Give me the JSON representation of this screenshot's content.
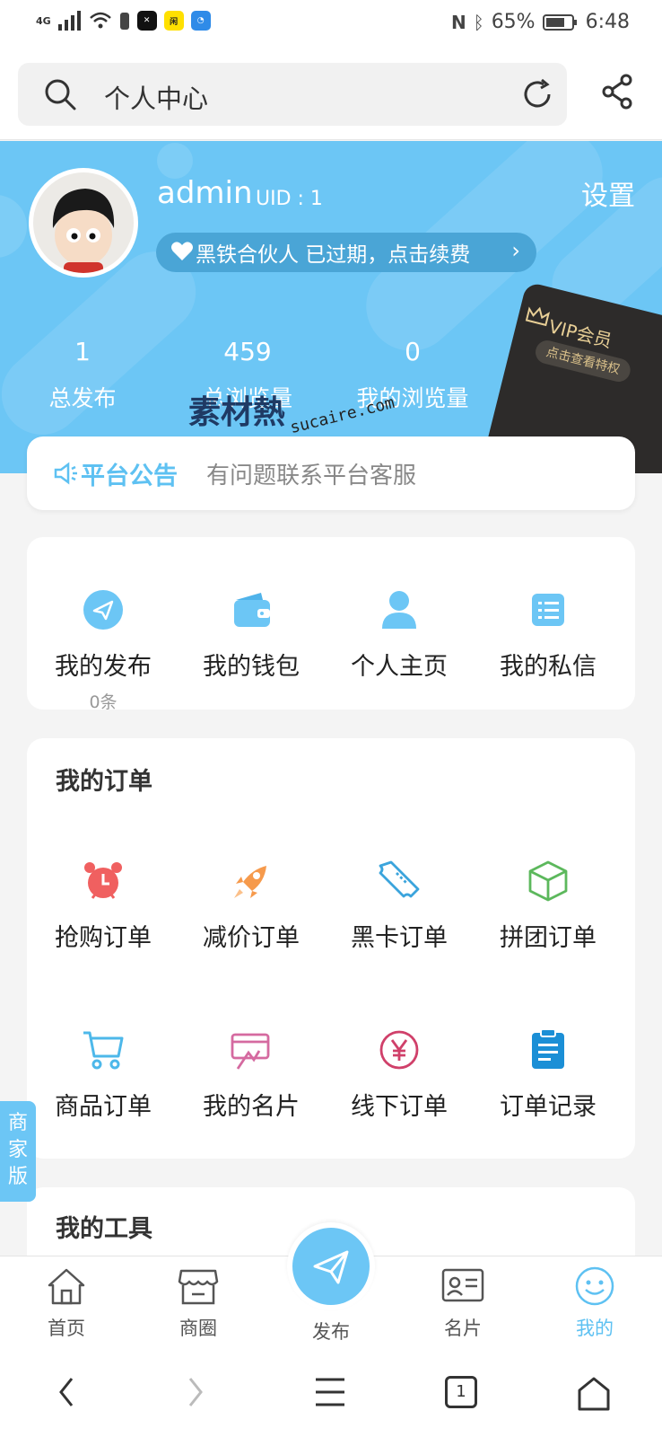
{
  "status_bar": {
    "network": "4G",
    "battery": "65%",
    "time": "6:48",
    "app_badges": [
      "capcut-icon",
      "xianyu-icon",
      "browser-icon"
    ]
  },
  "header": {
    "title": "个人中心"
  },
  "profile": {
    "username": "admin",
    "uid": "UID : 1",
    "settings": "设置",
    "membership": "黑铁合伙人 已过期，点击续费",
    "stats": [
      {
        "value": "1",
        "label": "总发布"
      },
      {
        "value": "459",
        "label": "总浏览量"
      },
      {
        "value": "0",
        "label": "我的浏览量"
      }
    ],
    "vip_card": {
      "title": "VIP会员",
      "subtitle": "点击查看特权"
    }
  },
  "watermark": {
    "brand": "素材熱",
    "domain": "sucaire.com"
  },
  "announcement": {
    "label": "平台公告",
    "text": "有问题联系平台客服"
  },
  "quick_actions": [
    {
      "label": "我的发布",
      "sub": "0条"
    },
    {
      "label": "我的钱包"
    },
    {
      "label": "个人主页"
    },
    {
      "label": "我的私信"
    }
  ],
  "orders": {
    "title": "我的订单",
    "items": [
      {
        "label": "抢购订单"
      },
      {
        "label": "减价订单"
      },
      {
        "label": "黑卡订单"
      },
      {
        "label": "拼团订单"
      },
      {
        "label": "商品订单"
      },
      {
        "label": "我的名片"
      },
      {
        "label": "线下订单"
      },
      {
        "label": "订单记录"
      }
    ]
  },
  "tools": {
    "title": "我的工具"
  },
  "merchant_tab": "商家版",
  "bottom_nav": [
    {
      "label": "首页"
    },
    {
      "label": "商圈"
    },
    {
      "label": "发布"
    },
    {
      "label": "名片"
    },
    {
      "label": "我的"
    }
  ],
  "system_nav": {
    "tab_count": "1"
  },
  "colors": {
    "primary": "#6cc6f5",
    "banner": "#6cc6f5",
    "active_nav": "#5ec1f2"
  }
}
